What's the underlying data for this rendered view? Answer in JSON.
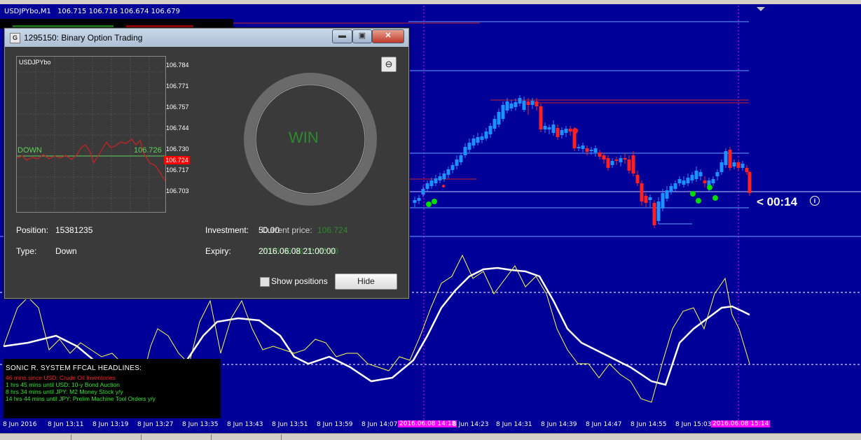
{
  "chart": {
    "symbol": "USDJPYbo,M1",
    "ohlc": "106.715 106.716 106.674 106.679",
    "timer": "< 00:14",
    "x_labels": [
      {
        "text": "8 Jun 2016",
        "hl": false
      },
      {
        "text": "8 Jun 13:11",
        "hl": false
      },
      {
        "text": "8 Jun 13:19",
        "hl": false
      },
      {
        "text": "8 Jun 13:27",
        "hl": false
      },
      {
        "text": "8 Jun 13:35",
        "hl": false
      },
      {
        "text": "8 Jun 13:43",
        "hl": false
      },
      {
        "text": "8 Jun 13:51",
        "hl": false
      },
      {
        "text": "8 Jun 13:59",
        "hl": false
      },
      {
        "text": "8 Jun 14:07",
        "hl": false
      },
      {
        "text": "2016.06.08 14:18",
        "hl": true
      },
      {
        "text": "8 Jun 14:23",
        "hl": false
      },
      {
        "text": "8 Jun 14:31",
        "hl": false
      },
      {
        "text": "8 Jun 14:39",
        "hl": false
      },
      {
        "text": "8 Jun 14:47",
        "hl": false
      },
      {
        "text": "8 Jun 14:55",
        "hl": false
      },
      {
        "text": "8 Jun 15:03",
        "hl": false
      },
      {
        "text": "2016.06.08 15:14",
        "hl": true
      }
    ]
  },
  "headlines": {
    "header": "SONIC R. SYSTEM  FFCAL HEADLINES:",
    "lines": [
      {
        "text": "46 mins since USD: Crude Oil Inventories",
        "color": "#ff2020"
      },
      {
        "text": "1 hrs 45 mins until USD: 10-y Bond Auction",
        "color": "#2fe82f"
      },
      {
        "text": "8 hrs 34 mins until JPY: M2 Money Stock y/y",
        "color": "#2fe82f"
      },
      {
        "text": "14 hrs 44 mins until JPY: Prelim Machine Tool Orders y/y",
        "color": "#2fe82f"
      }
    ]
  },
  "dialog": {
    "title": "1295150: Binary Option Trading",
    "icon_text": "G",
    "min_label": "▬",
    "max_label": "▣",
    "close_label": "✕",
    "back_glyph": "⊖",
    "symbol": "USDJPYbo",
    "price_ticks": [
      "106.784",
      "106.771",
      "106.757",
      "106.744",
      "106.730",
      "106.717",
      "106.703"
    ],
    "current_price_tag": "106.724",
    "direction_label": "DOWN",
    "strike_value": "106.726",
    "result": "WIN",
    "position_label": "Position:",
    "position_value": "15381235",
    "type_label": "Type:",
    "type_value": "Down",
    "investment_label": "Investment:",
    "investment_value": "50.00",
    "current_price_label": "Current price:",
    "current_price_value": "106.724",
    "expiry_label": "Expiry:",
    "expiry_value": "2016.06.08 21:00:00",
    "expiry_ghost": "2016.06.08 21:00:00",
    "show_positions_label": "Show positions",
    "hide_label": "Hide"
  },
  "colors": {
    "background": "#000099",
    "bull_candle": "#1e90ff",
    "bear_candle": "#ff2020",
    "signal_dot": "#00dd00",
    "highlight": "#ff00ff"
  },
  "icons": [
    "chart-window-icon",
    "collapse-triangle-icon",
    "timer-info-icon",
    "back-arrow-icon",
    "checkbox-icon"
  ]
}
